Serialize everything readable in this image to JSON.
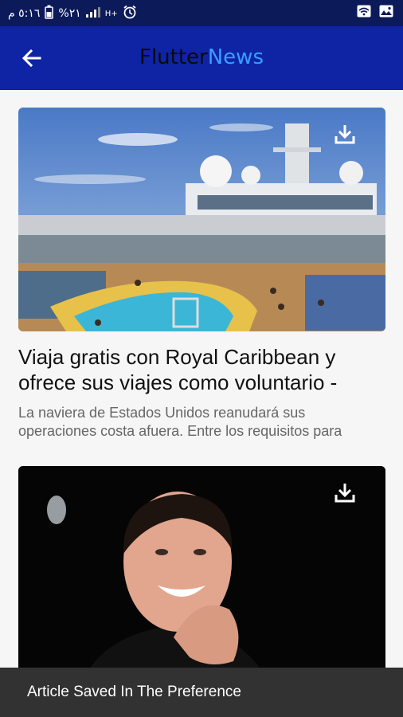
{
  "status_bar": {
    "time": "٥:١٦ م",
    "battery": "%٢١",
    "network": "H+",
    "icons": [
      "battery-icon",
      "signal-icon",
      "alarm-icon",
      "wifi-icon",
      "image-icon"
    ]
  },
  "app_bar": {
    "title_part1": "Flutter",
    "title_part2": "News",
    "back_icon": "arrow-left-icon"
  },
  "articles": [
    {
      "title_line1": "Viaja gratis con Royal Caribbean y",
      "title_line2": "ofrece sus viajes como voluntario -",
      "desc_line1": "La naviera de Estados Unidos reanudará sus",
      "desc_line2": "operaciones costa afuera. Entre los requisitos para",
      "download_icon": "download-icon"
    },
    {
      "download_icon": "download-icon"
    }
  ],
  "snackbar": {
    "message": "Article Saved In The Preference"
  },
  "colors": {
    "app_bar": "#0f23a5",
    "status_bar": "#0c1a5a",
    "accent": "#3a9dff",
    "snackbar": "#323232"
  }
}
